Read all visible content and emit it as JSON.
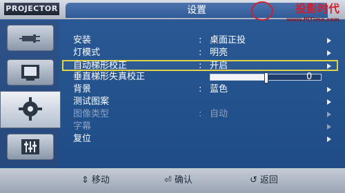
{
  "header": {
    "brand": "PROJECTOR",
    "title": "设置",
    "watermark_text": "投影时代",
    "watermark_url": "www.PjTime.com"
  },
  "sidebar": {
    "items": [
      {
        "name": "input-source",
        "icon": "plug-icon"
      },
      {
        "name": "picture",
        "icon": "screen-icon"
      },
      {
        "name": "setup",
        "icon": "gear-icon",
        "active": true
      },
      {
        "name": "option",
        "icon": "sliders-icon"
      }
    ]
  },
  "menu": {
    "rows": [
      {
        "label": "安装",
        "value": "桌面正投"
      },
      {
        "label": "灯模式",
        "value": "明亮"
      },
      {
        "label": "自动梯形校正",
        "value": "开启",
        "selected": true
      },
      {
        "label": "垂直梯形失真校正",
        "slider_value": "0",
        "slider_fraction": 0.5
      },
      {
        "label": "背景",
        "value": "蓝色"
      },
      {
        "label": "测试图案",
        "value": ""
      },
      {
        "label": "图像类型",
        "value": "自动",
        "disabled": true
      },
      {
        "label": "字幕",
        "value": "",
        "disabled": true
      },
      {
        "label": "复位",
        "value": ""
      }
    ]
  },
  "footer": {
    "move": "移动",
    "confirm": "确认",
    "back": "返回"
  },
  "colors": {
    "selection": "#e2d34a",
    "menu_background": "#23518c",
    "watermark": "#d21f2c"
  }
}
